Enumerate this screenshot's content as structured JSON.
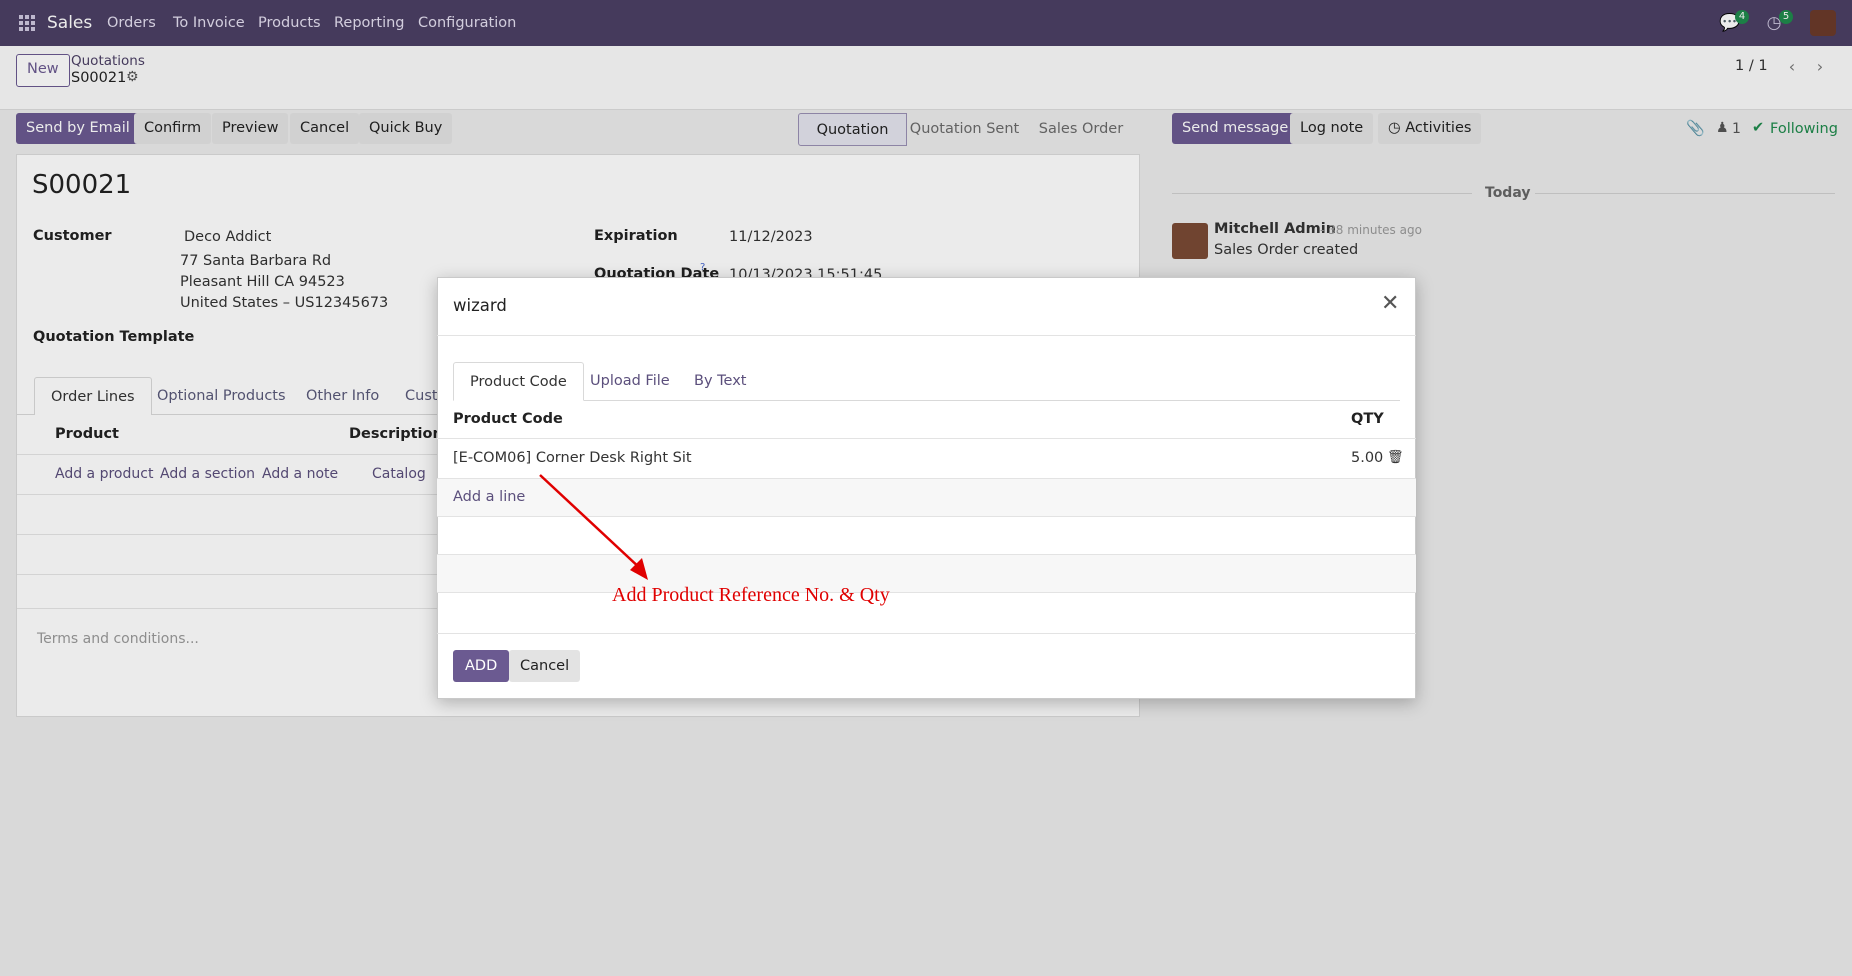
{
  "navbar": {
    "app_name": "Sales",
    "menu": [
      "Orders",
      "To Invoice",
      "Products",
      "Reporting",
      "Configuration"
    ],
    "messages_count": "4",
    "activities_count": "5"
  },
  "control_panel": {
    "new_label": "New",
    "breadcrumb_parent": "Quotations",
    "breadcrumb_current": "S00021",
    "pager": "1 / 1"
  },
  "actions": {
    "send_by_email": "Send by Email",
    "confirm": "Confirm",
    "preview": "Preview",
    "cancel": "Cancel",
    "quick_buy": "Quick Buy"
  },
  "statusbar": [
    "Quotation",
    "Quotation Sent",
    "Sales Order"
  ],
  "form": {
    "name": "S00021",
    "customer_label": "Customer",
    "customer_name": "Deco Addict",
    "address_line1": "77 Santa Barbara Rd",
    "address_line2": "Pleasant Hill CA 94523",
    "address_line3": "United States – US12345673",
    "expiration_label": "Expiration",
    "expiration_value": "11/12/2023",
    "quotation_date_label": "Quotation Date",
    "quotation_date_tooltip": "?",
    "quotation_date_value": "10/13/2023 15:51:45",
    "template_label": "Quotation Template",
    "tabs": [
      "Order Lines",
      "Optional Products",
      "Other Info",
      "Custo"
    ],
    "col_product": "Product",
    "col_description": "Description",
    "add_product": "Add a product",
    "add_section": "Add a section",
    "add_note": "Add a note",
    "catalog": "Catalog",
    "terms_placeholder": "Terms and conditions..."
  },
  "chatter": {
    "send_message": "Send message",
    "log_note": "Log note",
    "activities": "Activities",
    "followers_count": "1",
    "following": "Following",
    "date_separator": "Today",
    "author": "Mitchell Admin",
    "time_ago": "- 38 minutes ago",
    "body": "Sales Order created"
  },
  "wizard": {
    "title": "wizard",
    "tabs": [
      "Product Code",
      "Upload File",
      "By Text"
    ],
    "col_product_code": "Product Code",
    "col_qty": "QTY",
    "line_product": "[E-COM06] Corner Desk Right Sit",
    "line_qty": "5.00",
    "add_line": "Add a line",
    "add_button": "ADD",
    "cancel_button": "Cancel"
  },
  "annotation": {
    "text": "Add Product Reference No. & Qty",
    "color": "#e00000"
  },
  "colors": {
    "navbar": "#4b3f64",
    "primary": "#6b5a91",
    "following": "#1f8a4c"
  }
}
